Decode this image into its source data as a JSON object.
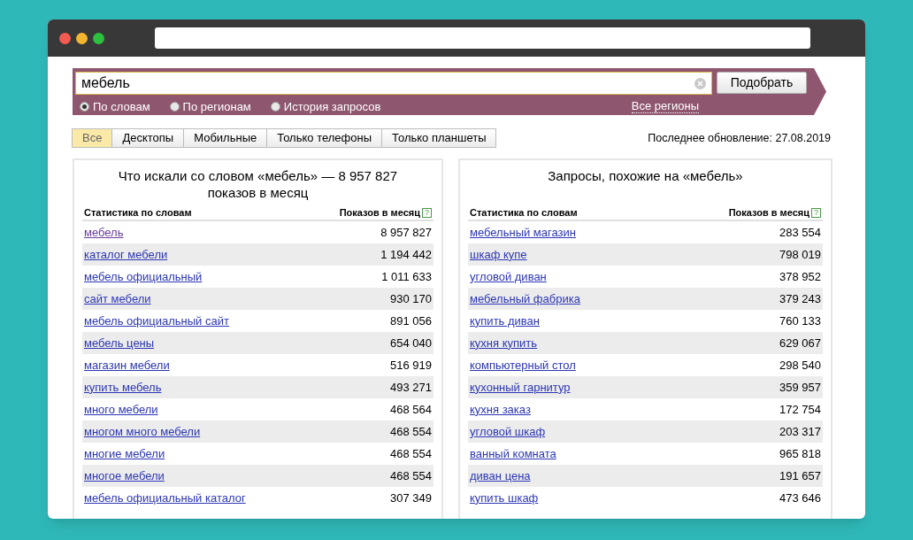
{
  "search": {
    "value": "мебель",
    "button": "Подобрать",
    "region_link": "Все регионы",
    "modes": [
      {
        "label": "По словам",
        "selected": true
      },
      {
        "label": "По регионам",
        "selected": false
      },
      {
        "label": "История запросов",
        "selected": false
      }
    ]
  },
  "tabs": [
    {
      "label": "Все",
      "selected": true
    },
    {
      "label": "Десктопы",
      "selected": false
    },
    {
      "label": "Мобильные",
      "selected": false
    },
    {
      "label": "Только телефоны",
      "selected": false
    },
    {
      "label": "Только планшеты",
      "selected": false
    }
  ],
  "last_update": "Последнее обновление: 27.08.2019",
  "panels": [
    {
      "title": "Что искали со словом «мебель» — 8 957 827 показов в месяц",
      "columns": [
        "Статистика по словам",
        "Показов в месяц"
      ],
      "help_mark": "?",
      "rows": [
        {
          "query": "мебель",
          "count": "8 957 827",
          "visited": true
        },
        {
          "query": "каталог мебели",
          "count": "1 194 442",
          "visited": false
        },
        {
          "query": "мебель официальный",
          "count": "1 011 633",
          "visited": false
        },
        {
          "query": "сайт мебели",
          "count": "930 170",
          "visited": false
        },
        {
          "query": "мебель официальный сайт",
          "count": "891 056",
          "visited": false
        },
        {
          "query": "мебель цены",
          "count": "654 040",
          "visited": false
        },
        {
          "query": "магазин мебели",
          "count": "516 919",
          "visited": false
        },
        {
          "query": "купить мебель",
          "count": "493 271",
          "visited": false
        },
        {
          "query": "много мебели",
          "count": "468 564",
          "visited": false
        },
        {
          "query": "многом много мебели",
          "count": "468 554",
          "visited": false
        },
        {
          "query": "многие мебели",
          "count": "468 554",
          "visited": false
        },
        {
          "query": "многое мебели",
          "count": "468 554",
          "visited": false
        },
        {
          "query": "мебель официальный каталог",
          "count": "307 349",
          "visited": false
        }
      ]
    },
    {
      "title": "Запросы, похожие на «мебель»",
      "columns": [
        "Статистика по словам",
        "Показов в месяц"
      ],
      "help_mark": "?",
      "rows": [
        {
          "query": "мебельный магазин",
          "count": "283 554",
          "visited": false
        },
        {
          "query": "шкаф купе",
          "count": "798 019",
          "visited": false
        },
        {
          "query": "угловой диван",
          "count": "378 952",
          "visited": false
        },
        {
          "query": "мебельный фабрика",
          "count": "379 243",
          "visited": false
        },
        {
          "query": "купить диван",
          "count": "760 133",
          "visited": false
        },
        {
          "query": "кухня купить",
          "count": "629 067",
          "visited": false
        },
        {
          "query": "компьютерный стол",
          "count": "298 540",
          "visited": false
        },
        {
          "query": "кухонный гарнитур",
          "count": "359 957",
          "visited": false
        },
        {
          "query": "кухня заказ",
          "count": "172 754",
          "visited": false
        },
        {
          "query": "угловой шкаф",
          "count": "203 317",
          "visited": false
        },
        {
          "query": "ванный комната",
          "count": "965 818",
          "visited": false
        },
        {
          "query": "диван цена",
          "count": "191 657",
          "visited": false
        },
        {
          "query": "купить шкаф",
          "count": "473 646",
          "visited": false
        }
      ]
    }
  ]
}
